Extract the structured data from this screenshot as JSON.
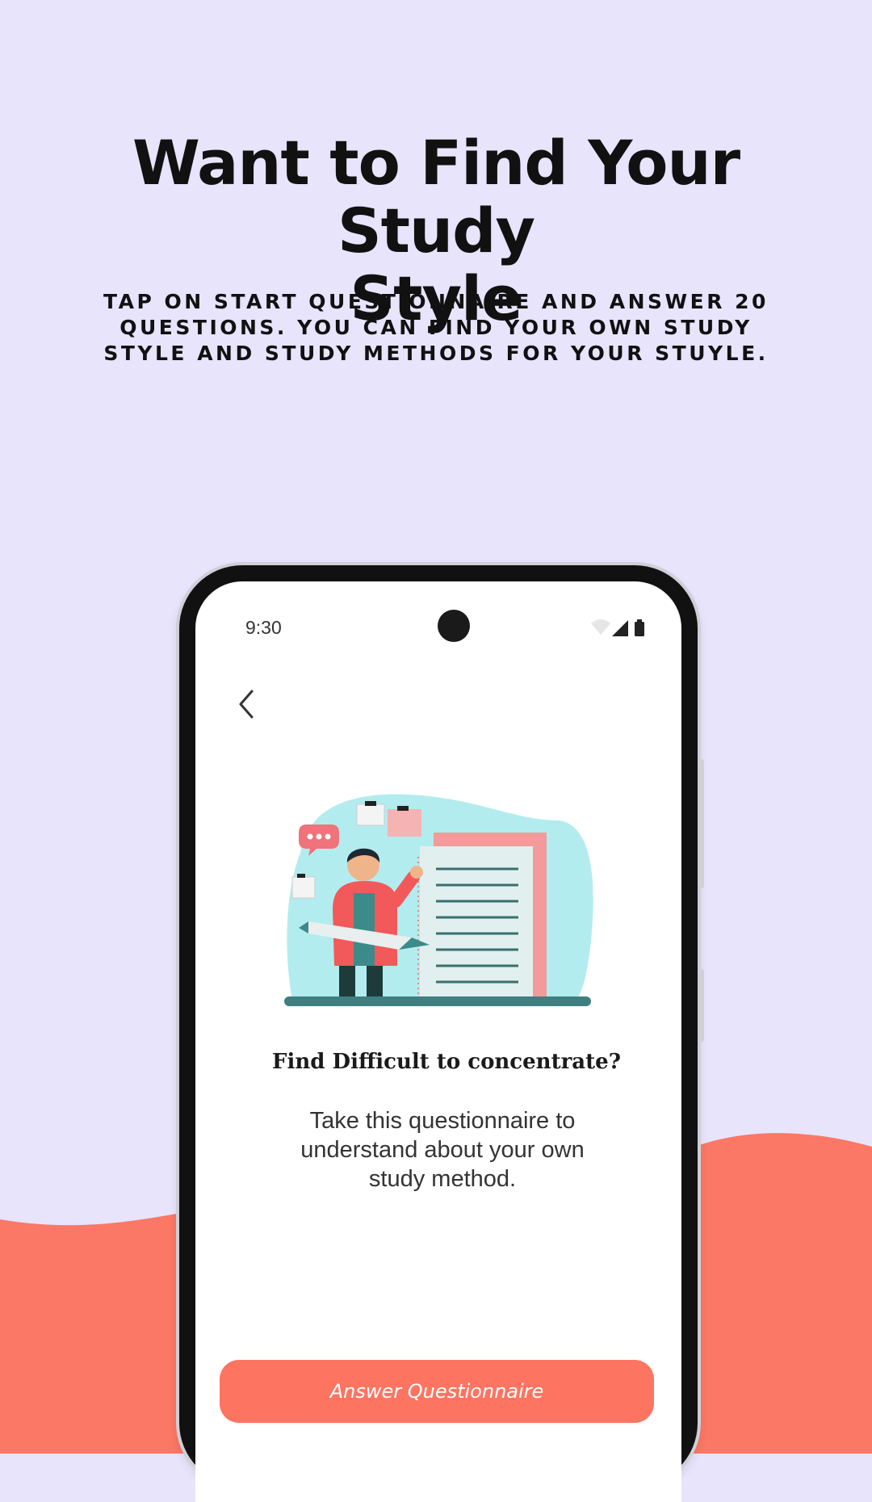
{
  "colors": {
    "background": "#e8e4fc",
    "accent": "#fd7461",
    "phone_frame": "#111111"
  },
  "headline": {
    "line1": "Want to Find Your Study",
    "line2": "Style"
  },
  "subtitle": {
    "line1": "TAP ON START QUESTIONNAIRE AND ANSWER 20",
    "line2": "QUESTIONS. YOU CAN FIND YOUR OWN STUDY",
    "line3": "STYLE AND STUDY METHODS FOR YOUR STUYLE."
  },
  "phone": {
    "status_bar": {
      "time": "9:30",
      "icons": [
        "wifi-icon",
        "signal-icon",
        "battery-icon"
      ]
    },
    "back_icon": "chevron-left-icon",
    "illustration": "teacher-with-pencil-and-checklist-illustration",
    "question_title": "Find Difficult to concentrate?",
    "description": {
      "line1": "Take this questionnaire to",
      "line2": "understand about your own",
      "line3": "study method."
    },
    "cta_label": "Answer Questionnaire"
  }
}
